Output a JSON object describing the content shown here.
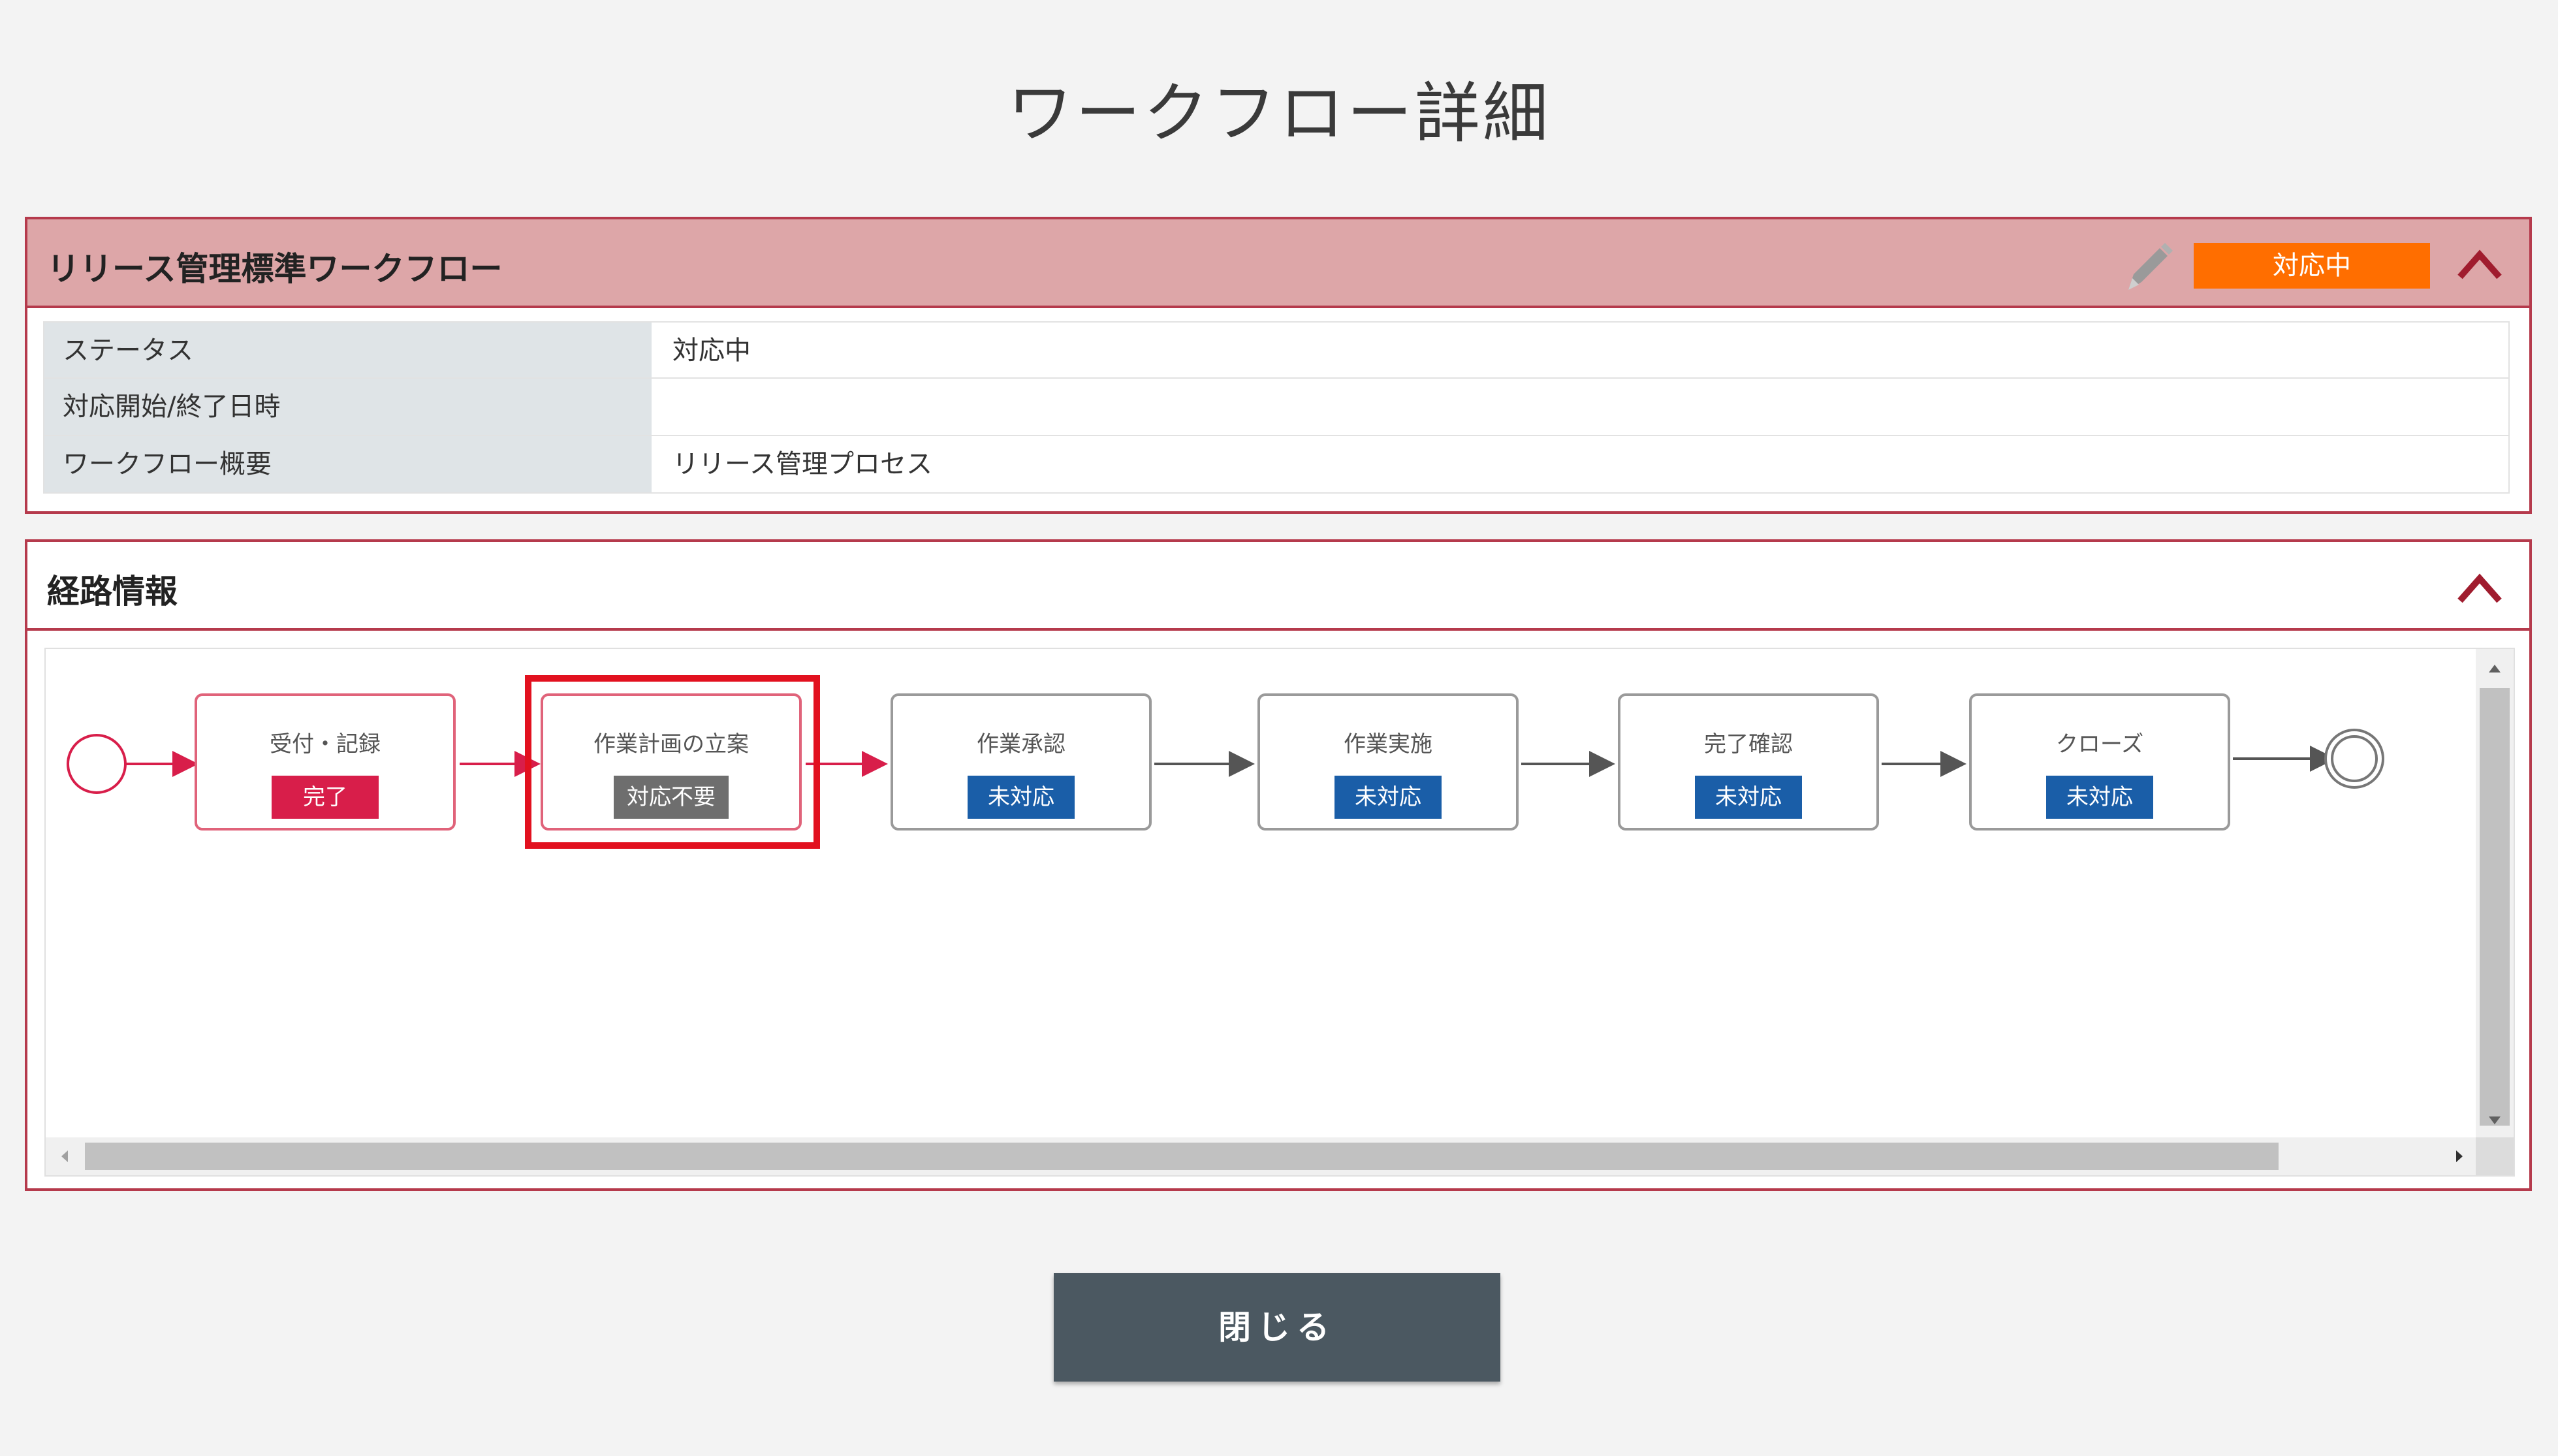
{
  "page": {
    "title": "ワークフロー詳細"
  },
  "workflow": {
    "name": "リリース管理標準ワークフロー",
    "status_badge": "対応中",
    "colors": {
      "header_bg": "#dda6a8",
      "border": "#b53a4c",
      "badge": "#ff6e00"
    },
    "rows": [
      {
        "label": "ステータス",
        "value": "対応中"
      },
      {
        "label": "対応開始/終了日時",
        "value": ""
      },
      {
        "label": "ワークフロー概要",
        "value": "リリース管理プロセス"
      }
    ]
  },
  "route": {
    "title": "経路情報",
    "nodes": [
      {
        "name": "受付・記録",
        "status": "完了",
        "state": "done"
      },
      {
        "name": "作業計画の立案",
        "status": "対応不要",
        "state": "na",
        "highlighted": true
      },
      {
        "name": "作業承認",
        "status": "未対応",
        "state": "todo"
      },
      {
        "name": "作業実施",
        "status": "未対応",
        "state": "todo"
      },
      {
        "name": "完了確認",
        "status": "未対応",
        "state": "todo"
      },
      {
        "name": "クローズ",
        "status": "未対応",
        "state": "todo"
      }
    ]
  },
  "footer": {
    "close_label": "閉じる"
  },
  "icons": {
    "edit": "pencil-icon",
    "collapse": "chevron-up-icon"
  }
}
